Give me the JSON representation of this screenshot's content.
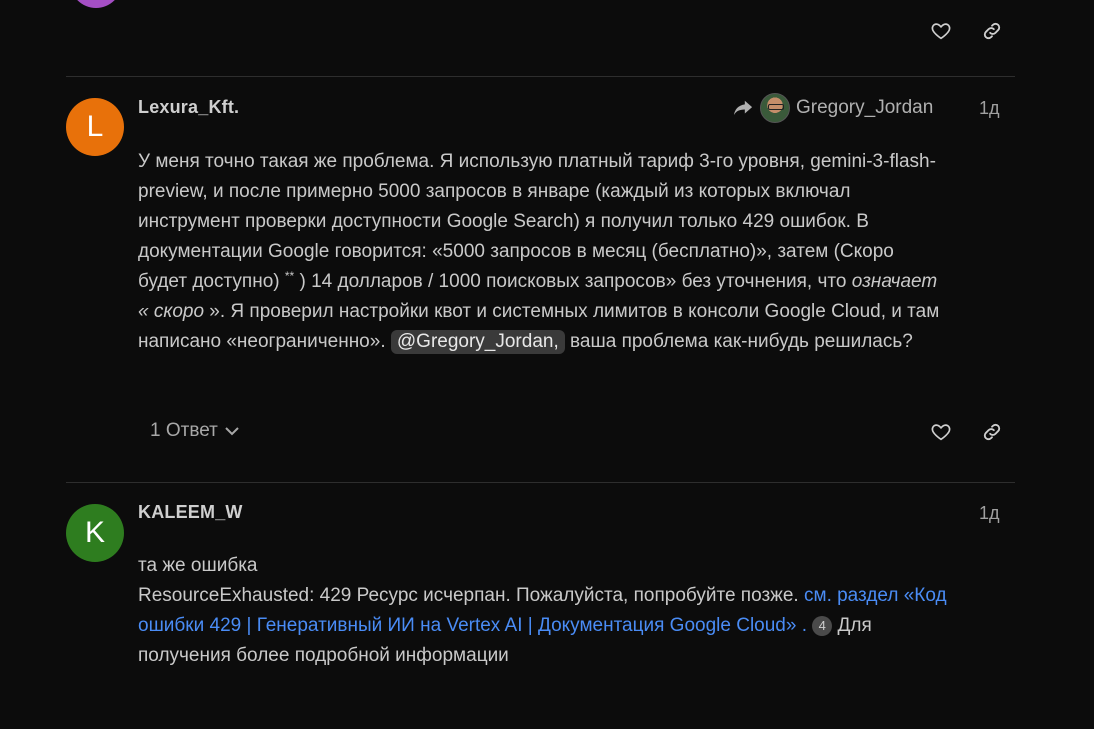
{
  "top_post": {
    "actions": {
      "like_icon": "heart-icon",
      "link_icon": "link-icon"
    }
  },
  "post1": {
    "author": "Lexura_Kft.",
    "avatar_letter": "L",
    "avatar_color": "#e8710a",
    "reply_to": "Gregory_Jordan",
    "time": "1д",
    "body": {
      "l1": "У меня точно такая же проблема. Я использую платный тариф 3-го уровня, gemini-3-flash-",
      "l2": "preview, и после примерно 5000 запросов в январе (каждый из которых включал",
      "l3": "инструмент проверки доступности Google Search) я получил только 429 ошибок. В",
      "l4": "документации Google говорится: «5000 запросов в месяц (бесплатно)», затем (Скоро",
      "l5a": "будет доступно) ",
      "l5sup": "**",
      "l5b": " ) 14 долларов / 1000 поисковых запросов» без уточнения, что ",
      "l5i": "означает",
      "l6i": "« скоро",
      "l6b": " ». Я проверил настройки квот и системных лимитов в консоли Google Cloud, и там",
      "l7a": "написано «неограниченно». ",
      "mention": "@Gregory_Jordan,",
      "l7b": " ваша проблема как-нибудь решилась?"
    },
    "replies_label": "1 Ответ"
  },
  "post2": {
    "author": "KALEEM_W",
    "avatar_letter": "K",
    "avatar_color": "#2e7d1f",
    "time": "1д",
    "body": {
      "l1": "та же ошибка",
      "l2a": "ResourceExhausted: 429 Ресурс исчерпан. Пожалуйста, попробуйте позже. ",
      "l2link": "см. раздел «Код",
      "l3link": "ошибки 429 | Генеративный ИИ на Vertex AI | Документация Google Cloud» .",
      "l3count": "4",
      "l3b": " Для",
      "l4": "получения более подробной информации"
    }
  }
}
